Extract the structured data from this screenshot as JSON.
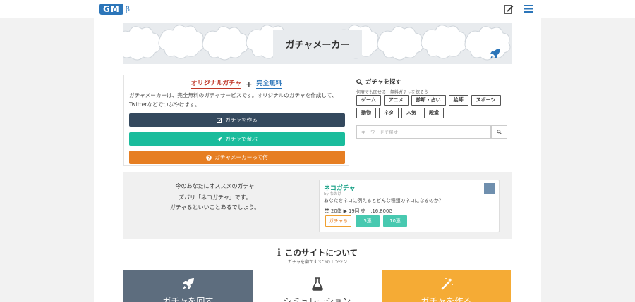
{
  "header": {
    "logo_text": "GM",
    "logo_beta": "β",
    "icons": [
      "edit-icon",
      "menu-icon"
    ]
  },
  "banner": {
    "title": "ガチャメーカー",
    "icon": "rocket-icon"
  },
  "intro": {
    "tag_original": "オリジナルガチャ",
    "tag_plus": "+",
    "tag_free": "完全無料",
    "description": "ガチャメーカーは、完全無料のガチャサービスです。オリジナルのガチャを作成して、Twitterなどでつぶやけます。",
    "buttons": {
      "make": "ガチャを作る",
      "play": "ガチャで遊ぶ",
      "about": "ガチャメーカーって何"
    }
  },
  "search": {
    "heading": "ガチャを探す",
    "note": "何度でも回せる！無料ガチャを探そう",
    "tags_row1": [
      "ゲーム",
      "アニメ",
      "診断・占い",
      "絵師",
      "スポーツ"
    ],
    "tags_row2": [
      "動物",
      "ネタ",
      "人気",
      "殿堂"
    ],
    "placeholder": "キーワードで探す"
  },
  "recommend": {
    "title": "今のあなたにオススメのガチャ",
    "line1": "ズバリ「ネコガチャ」です。",
    "line2": "ガチャるといいことあるでしょう。",
    "card": {
      "title": "ネコガチャ",
      "author": "by なおげ",
      "description": "あなたをネコに例えるとどんな種類のネコになるのか？",
      "stats": "20体 ▶ 19回 売上:16,800G",
      "btn_gacha": "ガチャる",
      "btn_5": "5連",
      "btn_10": "10連"
    }
  },
  "about": {
    "icon": "i",
    "title": "このサイトについて",
    "subtitle": "ガチャを動かす３つのエンジン",
    "features": {
      "rotate": "ガチャを回す",
      "simulation": "シミュレーション",
      "make": "ガチャを作る"
    }
  },
  "colors": {
    "brand_blue": "#2b75b9",
    "dark_button": "#34495e",
    "teal_button": "#1abc9c",
    "orange_button": "#e67e22",
    "feature_gray": "#5d6d7e",
    "feature_orange": "#f5ab35"
  }
}
